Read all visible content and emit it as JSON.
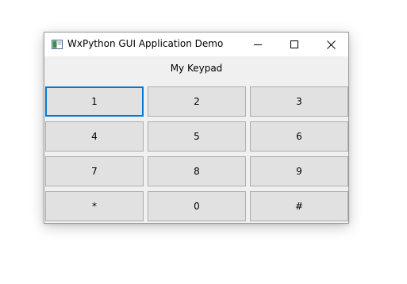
{
  "window": {
    "title": "WxPython GUI Application Demo",
    "controls": [
      "minimize",
      "maximize",
      "close"
    ]
  },
  "heading": "My Keypad",
  "keypad": {
    "keys": [
      "1",
      "2",
      "3",
      "4",
      "5",
      "6",
      "7",
      "8",
      "9",
      "*",
      "0",
      "#"
    ],
    "focused_key": "1"
  },
  "colors": {
    "focus_border": "#0078d7",
    "button_face": "#e1e1e1",
    "window_background": "#f0f0f0"
  },
  "icons": {
    "app": "app-icon",
    "minimize": "minimize-icon",
    "maximize": "maximize-icon",
    "close": "close-icon"
  }
}
